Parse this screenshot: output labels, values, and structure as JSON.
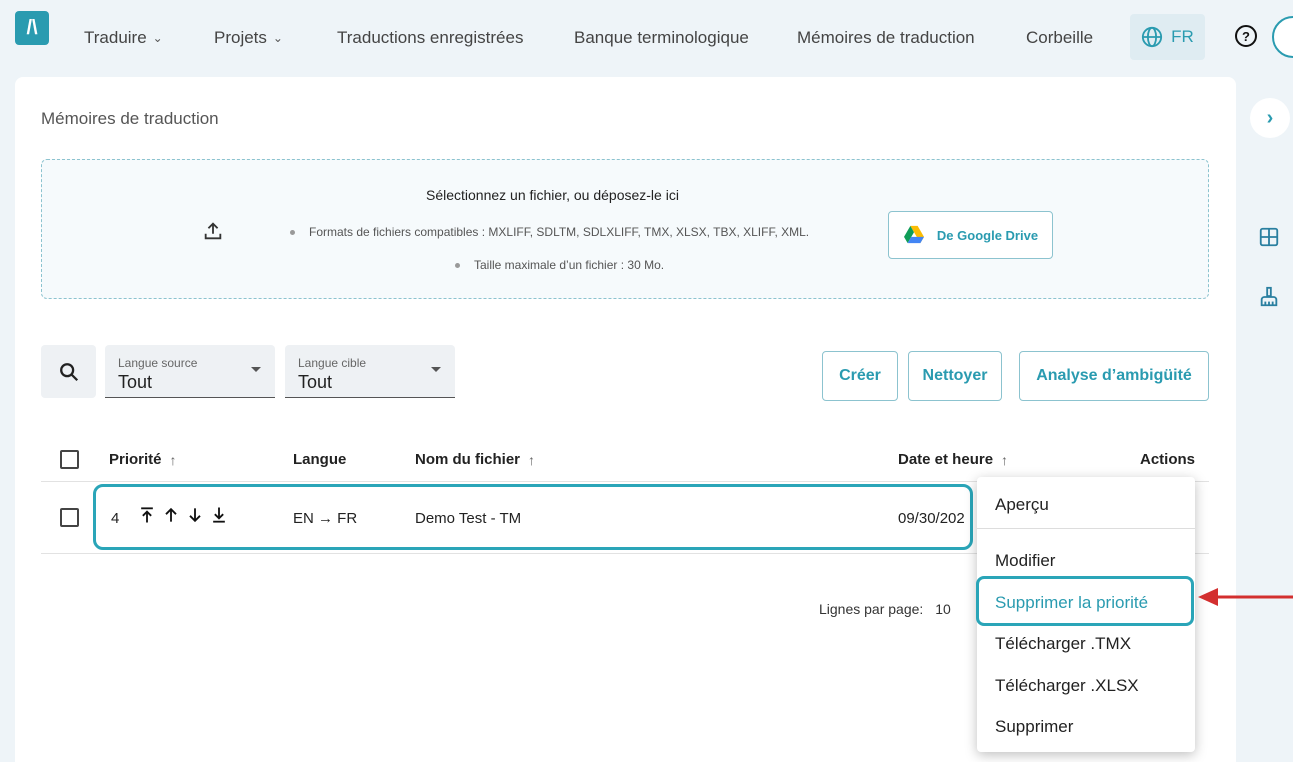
{
  "nav": {
    "logo": "/\\",
    "items": [
      {
        "label": "Traduire",
        "dropdown": true
      },
      {
        "label": "Projets",
        "dropdown": true
      },
      {
        "label": "Traductions enregistrées",
        "dropdown": false
      },
      {
        "label": "Banque terminologique",
        "dropdown": false
      },
      {
        "label": "Mémoires de traduction",
        "dropdown": false
      },
      {
        "label": "Corbeille",
        "dropdown": false
      }
    ],
    "language": "FR",
    "help": "?"
  },
  "page": {
    "title": "Mémoires de traduction"
  },
  "dropzone": {
    "title": "Sélectionnez un fichier, ou déposez-le ici",
    "formats": "Formats de fichiers compatibles : MXLIFF, SDLTM, SDLXLIFF, TMX, XLSX, TBX, XLIFF, XML.",
    "max_size": "Taille maximale d’un fichier : 30 Mo.",
    "gdrive_label": "De Google Drive"
  },
  "filters": {
    "source": {
      "label": "Langue source",
      "value": "Tout"
    },
    "target": {
      "label": "Langue cible",
      "value": "Tout"
    }
  },
  "actions": {
    "create": "Créer",
    "clean": "Nettoyer",
    "ambiguity": "Analyse d’ambigüité"
  },
  "table": {
    "headers": {
      "priority": "Priorité",
      "language": "Langue",
      "filename": "Nom du fichier",
      "datetime": "Date et heure",
      "actions": "Actions"
    },
    "sort_arrow": "↑",
    "rows": [
      {
        "priority": "4",
        "language": "EN → FR",
        "filename": "Demo Test - TM",
        "date": "09/30/202"
      }
    ]
  },
  "pagination": {
    "rows_per_page_label": "Lignes par page:",
    "rows_per_page": "10"
  },
  "menu": {
    "items": [
      "Aperçu",
      "Modifier",
      "Supprimer la priorité",
      "Télécharger .TMX",
      "Télécharger .XLSX",
      "Supprimer"
    ],
    "highlighted_index": 2
  },
  "colors": {
    "accent": "#2a9bb0",
    "highlight_border": "#2aa5b8",
    "annotation_arrow": "#d32f2f",
    "background": "#eef4f8"
  }
}
